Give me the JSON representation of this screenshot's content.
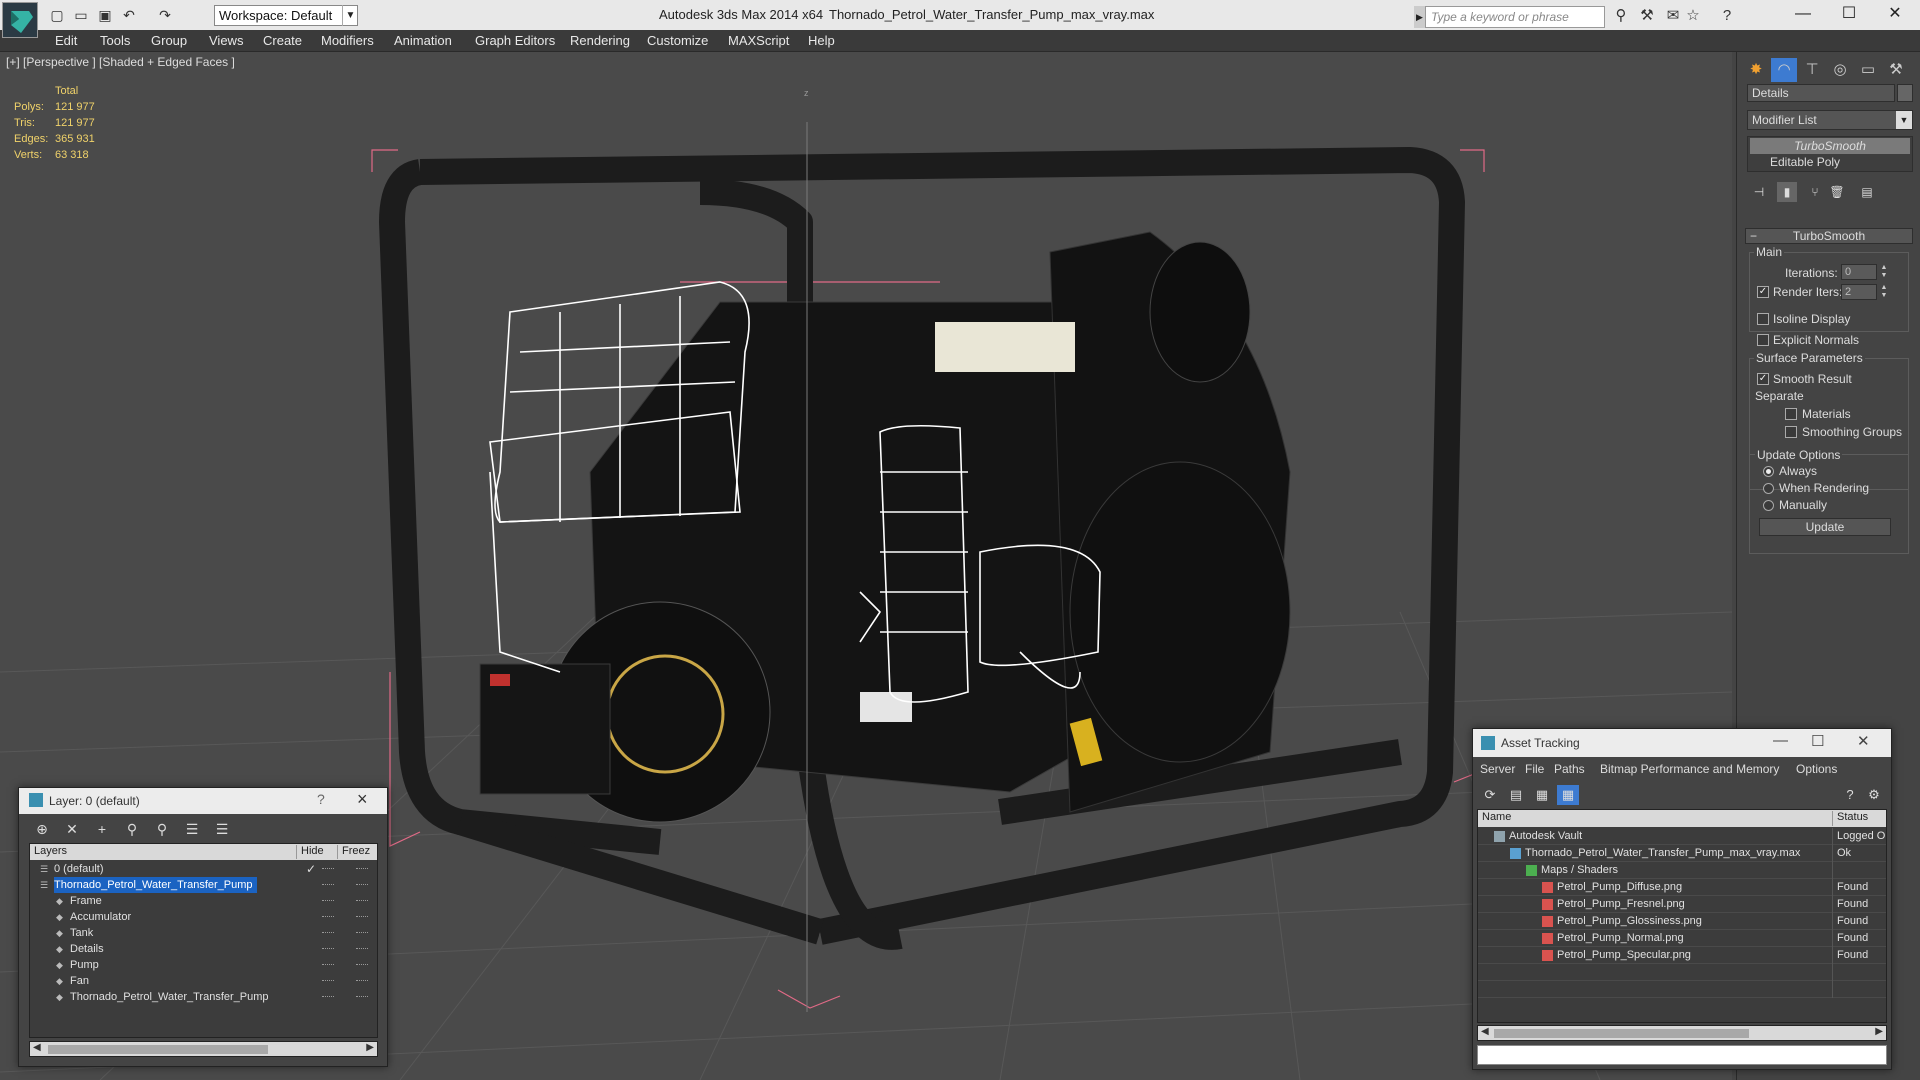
{
  "titlebar": {
    "workspace": "Workspace: Default",
    "app_title": "Autodesk 3ds Max  2014 x64",
    "file_title": "Thornado_Petrol_Water_Transfer_Pump_max_vray.max",
    "search_placeholder": "Type a keyword or phrase"
  },
  "menu": [
    "Edit",
    "Tools",
    "Group",
    "Views",
    "Create",
    "Modifiers",
    "Animation",
    "Graph Editors",
    "Rendering",
    "Customize",
    "MAXScript",
    "Help"
  ],
  "viewport": {
    "label": "[+] [Perspective ] [Shaded + Edged Faces ]",
    "stats": {
      "header": "Total",
      "rows": [
        {
          "k": "Polys:",
          "v": "121 977"
        },
        {
          "k": "Tris:",
          "v": "121 977"
        },
        {
          "k": "Edges:",
          "v": "365 931"
        },
        {
          "k": "Verts:",
          "v": "63 318"
        }
      ]
    },
    "axis_label": "z",
    "colors": {
      "background": "#4a4a4a",
      "grid": "#5a5a5a",
      "bbox": "#e06a86",
      "wire": "#ffffff",
      "frame": "#1c1c1c"
    }
  },
  "command_panel": {
    "name_field": "Details",
    "modifier_list": "Modifier List",
    "stack": [
      "TurboSmooth",
      "Editable Poly"
    ],
    "rollout_title": "TurboSmooth",
    "main_group": "Main",
    "iterations_label": "Iterations:",
    "iterations_value": "0",
    "render_iters_label": "Render Iters:",
    "render_iters_value": "2",
    "isoline": "Isoline Display",
    "explicit_normals": "Explicit Normals",
    "surface_group": "Surface Parameters",
    "smooth_result": "Smooth Result",
    "separate": "Separate",
    "materials": "Materials",
    "smoothing_groups": "Smoothing Groups",
    "update_group": "Update Options",
    "always": "Always",
    "when_rendering": "When Rendering",
    "manually": "Manually",
    "update_button": "Update"
  },
  "layer_panel": {
    "title": "Layer: 0 (default)",
    "columns": [
      "Layers",
      "Hide",
      "Freez"
    ],
    "rows": [
      {
        "name": "0 (default)",
        "level": 0,
        "checked": true
      },
      {
        "name": "Thornado_Petrol_Water_Transfer_Pump",
        "level": 0,
        "selected": true
      },
      {
        "name": "Frame",
        "level": 1
      },
      {
        "name": "Accumulator",
        "level": 1
      },
      {
        "name": "Tank",
        "level": 1
      },
      {
        "name": "Details",
        "level": 1
      },
      {
        "name": "Pump",
        "level": 1
      },
      {
        "name": "Fan",
        "level": 1
      },
      {
        "name": "Thornado_Petrol_Water_Transfer_Pump",
        "level": 1
      }
    ]
  },
  "asset_panel": {
    "title": "Asset Tracking",
    "menu": [
      "Server",
      "File",
      "Paths",
      "Bitmap Performance and Memory",
      "Options"
    ],
    "columns": [
      "Name",
      "Status"
    ],
    "rows": [
      {
        "name": "Autodesk Vault",
        "status": "Logged O",
        "level": 0,
        "icon": "vault"
      },
      {
        "name": "Thornado_Petrol_Water_Transfer_Pump_max_vray.max",
        "status": "Ok",
        "level": 1,
        "icon": "max"
      },
      {
        "name": "Maps / Shaders",
        "status": "",
        "level": 2,
        "icon": "maps"
      },
      {
        "name": "Petrol_Pump_Diffuse.png",
        "status": "Found",
        "level": 3,
        "icon": "png"
      },
      {
        "name": "Petrol_Pump_Fresnel.png",
        "status": "Found",
        "level": 3,
        "icon": "png"
      },
      {
        "name": "Petrol_Pump_Glossiness.png",
        "status": "Found",
        "level": 3,
        "icon": "png"
      },
      {
        "name": "Petrol_Pump_Normal.png",
        "status": "Found",
        "level": 3,
        "icon": "png"
      },
      {
        "name": "Petrol_Pump_Specular.png",
        "status": "Found",
        "level": 3,
        "icon": "png"
      }
    ]
  }
}
